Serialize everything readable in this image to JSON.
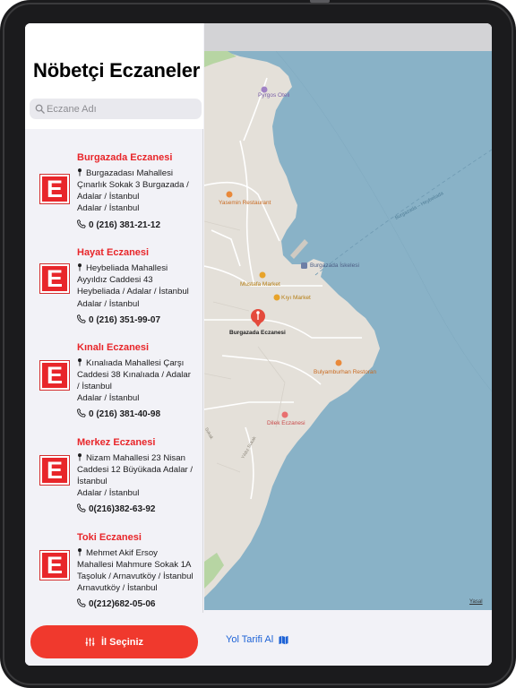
{
  "sidebar": {
    "title": "Nöbetçi Eczaneler",
    "search_placeholder": "Eczane Adı",
    "logo_letter": "E",
    "pharmacies": [
      {
        "name": "Burgazada Eczanesi",
        "address": "Burgazadası Mahallesi Çınarlık Sokak 3 Burgazada / Adalar / İstanbul",
        "district": "Adalar / İstanbul",
        "phone": "0 (216) 381-21-12"
      },
      {
        "name": "Hayat Eczanesi",
        "address": "Heybeliada Mahallesi Ayyıldız Caddesi 43 Heybeliada / Adalar / İstanbul",
        "district": "Adalar / İstanbul",
        "phone": "0 (216) 351-99-07"
      },
      {
        "name": "Kınalı Eczanesi",
        "address": "Kınalıada Mahallesi Çarşı Caddesi 38 Kınalıada / Adalar / İstanbul",
        "district": "Adalar / İstanbul",
        "phone": "0 (216) 381-40-98"
      },
      {
        "name": "Merkez Eczanesi",
        "address": "Nizam Mahallesi 23 Nisan Caddesi 12 Büyükada Adalar / İstanbul",
        "district": "Adalar / İstanbul",
        "phone": "0(216)382-63-92"
      },
      {
        "name": "Toki Eczanesi",
        "address": "Mehmet Akif Ersoy Mahallesi Mahmure Sokak 1A Taşoluk / Arnavutköy / İstanbul",
        "district": "Arnavutköy / İstanbul",
        "phone": "0(212)682-05-06"
      }
    ],
    "city_button_label": "İl Seçiniz"
  },
  "map": {
    "labels": {
      "pyrgos": "Pyrgos Oteli",
      "yasemin": "Yasemin Restaurant",
      "burgazada_iskelesi": "Burgazada İskelesi",
      "mustafa": "Mustafa Market",
      "kiyi": "Kıyı Market",
      "selected_pin": "Burgazada Eczanesi",
      "bulyamburhan": "Bulyamburhan Restoran",
      "dilek": "Dilek Eczanesi",
      "ferry_route": "Burgazada – Heybeliada",
      "street_sokak": "Sokak",
      "street_yildiz": "Yıldız Sokak"
    },
    "legal": "Yasal",
    "directions_label": "Yol Tarifi Al"
  },
  "colors": {
    "accent": "#e8262a",
    "button": "#f0392d",
    "link": "#1e63d6",
    "water": "#89b2c7",
    "land": "#e4e0d9"
  },
  "icons": [
    "search-icon",
    "map-pin-icon",
    "phone-icon",
    "sliders-icon",
    "map-icon",
    "restaurant-icon",
    "shopping-icon",
    "hotel-icon",
    "ferry-icon",
    "pharmacy-icon"
  ]
}
